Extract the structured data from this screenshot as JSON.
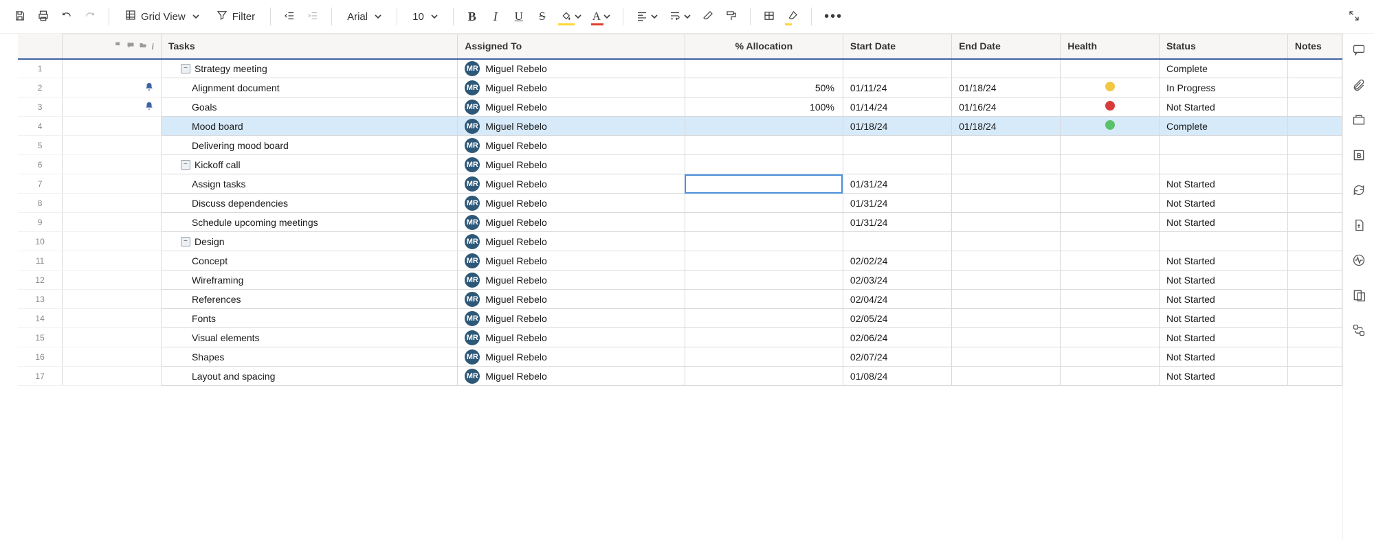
{
  "toolbar": {
    "view_label": "Grid View",
    "filter_label": "Filter",
    "font_label": "Arial",
    "size_label": "10"
  },
  "columns": {
    "tasks": "Tasks",
    "assigned": "Assigned To",
    "allocation": "% Allocation",
    "start": "Start Date",
    "end": "End Date",
    "health": "Health",
    "status": "Status",
    "notes": "Notes"
  },
  "assignee": {
    "initials": "MR",
    "name": "Miguel Rebelo"
  },
  "highlight_row": 4,
  "selected_cell": {
    "row": 7,
    "col": "allocation"
  },
  "rows": [
    {
      "num": 1,
      "indent": 1,
      "toggle": true,
      "bell": false,
      "task": "Strategy meeting",
      "alloc": "",
      "start": "",
      "end": "",
      "health": "",
      "status": "Complete"
    },
    {
      "num": 2,
      "indent": 2,
      "toggle": false,
      "bell": true,
      "task": "Alignment document",
      "alloc": "50%",
      "start": "01/11/24",
      "end": "01/18/24",
      "health": "yellow",
      "status": "In Progress"
    },
    {
      "num": 3,
      "indent": 2,
      "toggle": false,
      "bell": true,
      "task": "Goals",
      "alloc": "100%",
      "start": "01/14/24",
      "end": "01/16/24",
      "health": "red",
      "status": "Not Started"
    },
    {
      "num": 4,
      "indent": 2,
      "toggle": false,
      "bell": false,
      "task": "Mood board",
      "alloc": "",
      "start": "01/18/24",
      "end": "01/18/24",
      "health": "green",
      "status": "Complete"
    },
    {
      "num": 5,
      "indent": 2,
      "toggle": false,
      "bell": false,
      "task": "Delivering mood board",
      "alloc": "",
      "start": "",
      "end": "",
      "health": "",
      "status": ""
    },
    {
      "num": 6,
      "indent": 1,
      "toggle": true,
      "bell": false,
      "task": "Kickoff call",
      "alloc": "",
      "start": "",
      "end": "",
      "health": "",
      "status": ""
    },
    {
      "num": 7,
      "indent": 2,
      "toggle": false,
      "bell": false,
      "task": "Assign tasks",
      "alloc": "",
      "start": "01/31/24",
      "end": "",
      "health": "",
      "status": "Not Started"
    },
    {
      "num": 8,
      "indent": 2,
      "toggle": false,
      "bell": false,
      "task": "Discuss dependencies",
      "alloc": "",
      "start": "01/31/24",
      "end": "",
      "health": "",
      "status": "Not Started"
    },
    {
      "num": 9,
      "indent": 2,
      "toggle": false,
      "bell": false,
      "task": "Schedule upcoming meetings",
      "alloc": "",
      "start": "01/31/24",
      "end": "",
      "health": "",
      "status": "Not Started"
    },
    {
      "num": 10,
      "indent": 1,
      "toggle": true,
      "bell": false,
      "task": "Design",
      "alloc": "",
      "start": "",
      "end": "",
      "health": "",
      "status": ""
    },
    {
      "num": 11,
      "indent": 2,
      "toggle": false,
      "bell": false,
      "task": "Concept",
      "alloc": "",
      "start": "02/02/24",
      "end": "",
      "health": "",
      "status": "Not Started"
    },
    {
      "num": 12,
      "indent": 2,
      "toggle": false,
      "bell": false,
      "task": "Wireframing",
      "alloc": "",
      "start": "02/03/24",
      "end": "",
      "health": "",
      "status": "Not Started"
    },
    {
      "num": 13,
      "indent": 2,
      "toggle": false,
      "bell": false,
      "task": "References",
      "alloc": "",
      "start": "02/04/24",
      "end": "",
      "health": "",
      "status": "Not Started"
    },
    {
      "num": 14,
      "indent": 2,
      "toggle": false,
      "bell": false,
      "task": "Fonts",
      "alloc": "",
      "start": "02/05/24",
      "end": "",
      "health": "",
      "status": "Not Started"
    },
    {
      "num": 15,
      "indent": 2,
      "toggle": false,
      "bell": false,
      "task": "Visual elements",
      "alloc": "",
      "start": "02/06/24",
      "end": "",
      "health": "",
      "status": "Not Started"
    },
    {
      "num": 16,
      "indent": 2,
      "toggle": false,
      "bell": false,
      "task": "Shapes",
      "alloc": "",
      "start": "02/07/24",
      "end": "",
      "health": "",
      "status": "Not Started"
    },
    {
      "num": 17,
      "indent": 2,
      "toggle": false,
      "bell": false,
      "task": "Layout and spacing",
      "alloc": "",
      "start": "01/08/24",
      "end": "",
      "health": "",
      "status": "Not Started"
    }
  ]
}
